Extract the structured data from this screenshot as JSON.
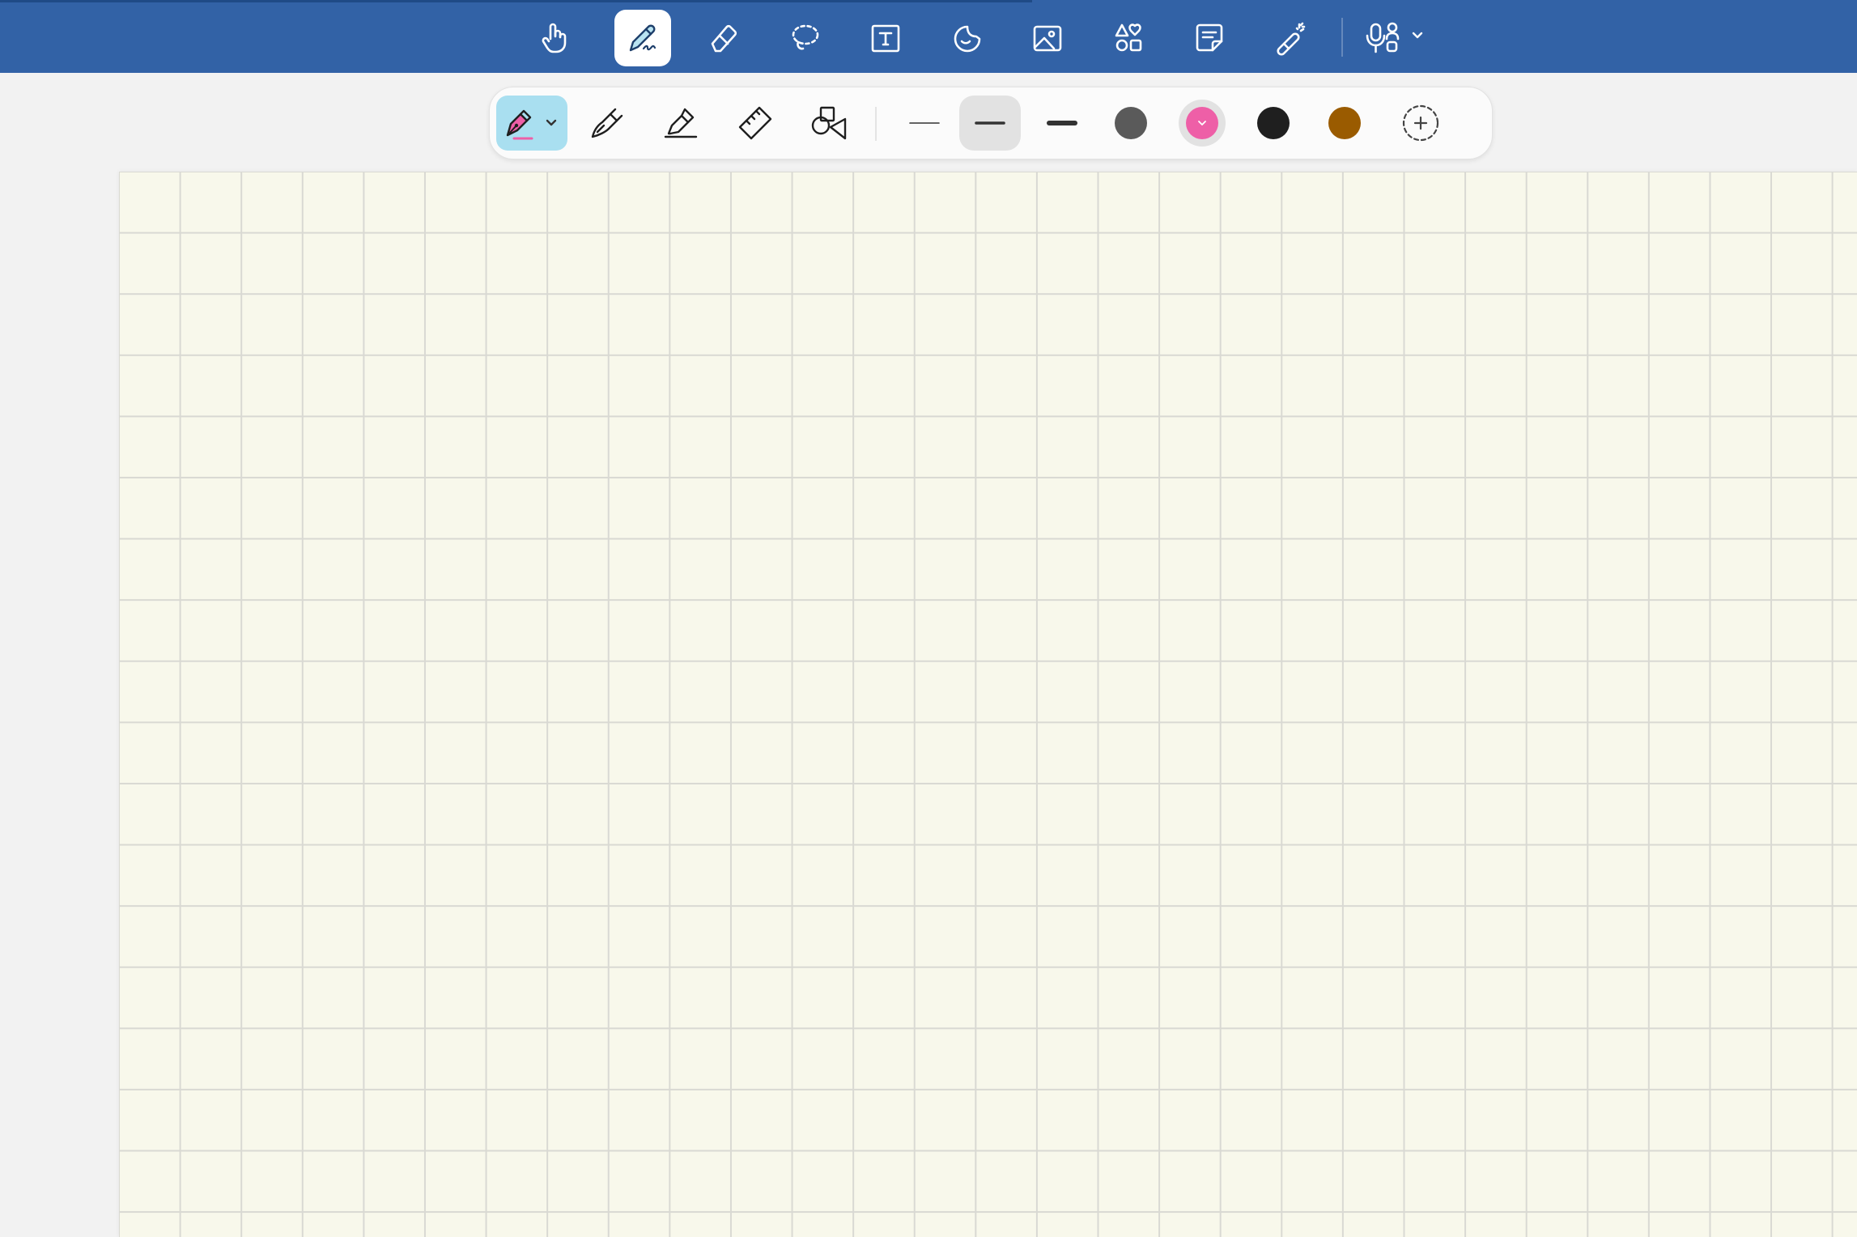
{
  "colors": {
    "topbar": "#3262a6",
    "active_pen_bg": "#a9dff0",
    "canvas": "#f8f8eb",
    "grid": "#d9d9d3"
  },
  "topbar": {
    "tools": [
      {
        "name": "hand-icon"
      },
      {
        "name": "pen-icon",
        "active": true
      },
      {
        "name": "eraser-icon"
      },
      {
        "name": "lasso-icon"
      },
      {
        "name": "text-box-icon"
      },
      {
        "name": "sticker-icon"
      },
      {
        "name": "image-icon"
      },
      {
        "name": "shapes-icon"
      },
      {
        "name": "sticky-note-icon"
      },
      {
        "name": "laser-pointer-icon"
      },
      {
        "name": "microphone-record-icon"
      }
    ]
  },
  "pen_toolbar": {
    "pen_types": [
      {
        "name": "fountain-pen-icon",
        "active": true
      },
      {
        "name": "brush-pen-icon"
      },
      {
        "name": "highlighter-icon"
      },
      {
        "name": "ruler-icon"
      },
      {
        "name": "shape-pen-icon"
      }
    ],
    "stroke_widths": [
      {
        "name": "thin",
        "value": 1
      },
      {
        "name": "medium",
        "value": 2,
        "active": true
      },
      {
        "name": "thick",
        "value": 3
      }
    ],
    "swatches": [
      {
        "color": "#5a5a5a"
      },
      {
        "color": "#ee5fa7",
        "active": true
      },
      {
        "color": "#1f1f1f"
      },
      {
        "color": "#9a5b00"
      }
    ]
  }
}
